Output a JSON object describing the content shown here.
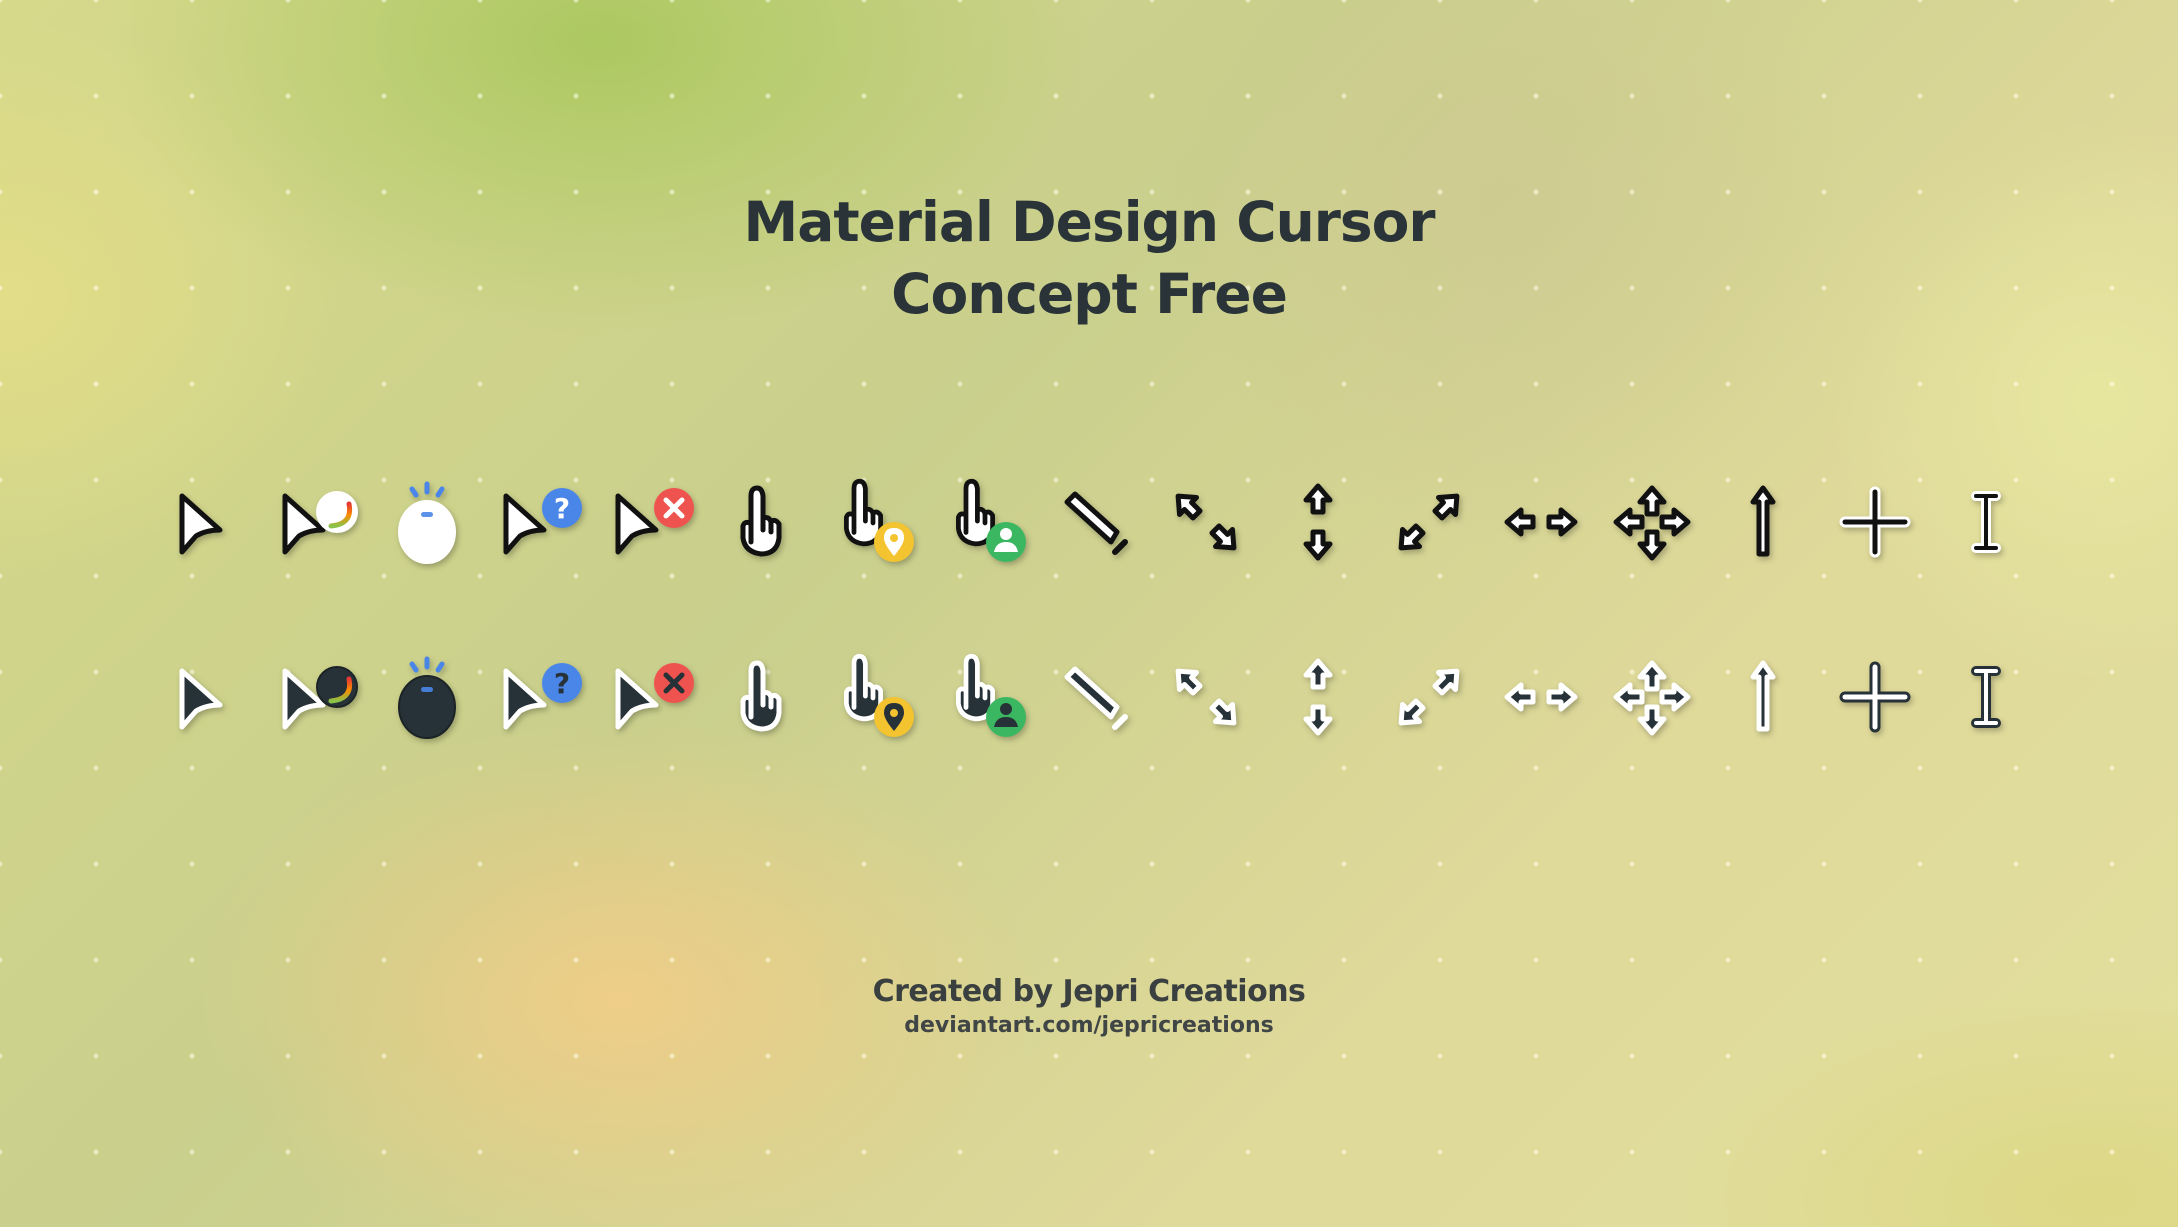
{
  "title": {
    "line1": "Material Design Cursor",
    "line2": "Concept Free"
  },
  "footer": {
    "credit": "Created by Jepri Creations",
    "link": "deviantart.com/jepricreations"
  },
  "colors": {
    "text": "#2a3338",
    "cursor_dark": "#263238",
    "cursor_light": "#ffffff",
    "help_blue": "#4a86e8",
    "error_red": "#ef5350",
    "pin_yellow": "#f4c430",
    "person_green": "#3cb761"
  },
  "cursor_sets": [
    {
      "variant": "light",
      "cursors": [
        "arrow-pointer-icon",
        "working-in-background-icon",
        "busy-icon",
        "help-select-icon",
        "unavailable-icon",
        "link-select-icon",
        "location-select-icon",
        "person-select-icon",
        "handwriting-icon",
        "diagonal-resize-1-icon",
        "vertical-resize-icon",
        "diagonal-resize-2-icon",
        "horizontal-resize-icon",
        "move-icon",
        "alternate-select-icon",
        "precision-select-icon",
        "text-select-icon"
      ]
    },
    {
      "variant": "dark",
      "cursors": [
        "arrow-pointer-icon",
        "working-in-background-icon",
        "busy-icon",
        "help-select-icon",
        "unavailable-icon",
        "link-select-icon",
        "location-select-icon",
        "person-select-icon",
        "handwriting-icon",
        "diagonal-resize-1-icon",
        "vertical-resize-icon",
        "diagonal-resize-2-icon",
        "horizontal-resize-icon",
        "move-icon",
        "alternate-select-icon",
        "precision-select-icon",
        "text-select-icon"
      ]
    }
  ]
}
